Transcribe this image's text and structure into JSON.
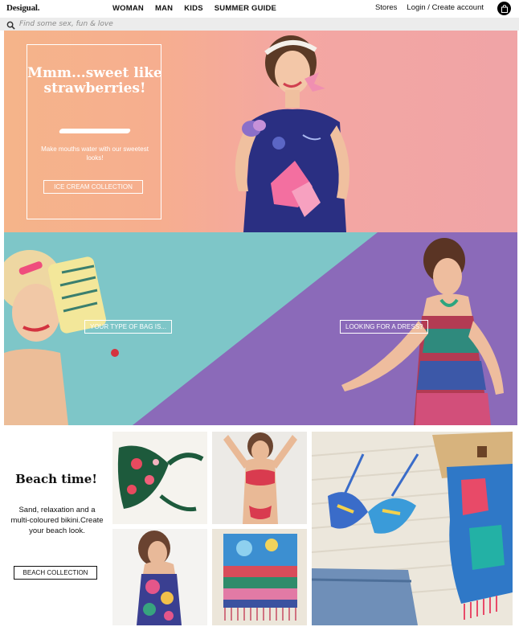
{
  "header": {
    "logo": "Desigual.",
    "nav": [
      "WOMAN",
      "MAN",
      "KIDS",
      "SUMMER GUIDE"
    ],
    "stores": "Stores",
    "login": "Login / Create account"
  },
  "search": {
    "placeholder": "Find some sex, fun & love"
  },
  "hero": {
    "title": "Mmm...sweet like strawberries!",
    "subtitle": "Make mouths water with our sweetest looks!",
    "button": "ICE CREAM COLLECTION"
  },
  "split_banner": {
    "left_button": "YOUR TYPE OF BAG IS...",
    "right_button": "LOOKING FOR A DRESS?"
  },
  "beach": {
    "title": "Beach time!",
    "description": "Sand, relaxation and a multi-coloured bikini.Create your beach look.",
    "button": "BEACH COLLECTION"
  },
  "colors": {
    "hero_peach": "#f5b48a",
    "hero_pink": "#f0a4a6",
    "teal": "#7fc6c8",
    "purple": "#8b6ab9"
  }
}
